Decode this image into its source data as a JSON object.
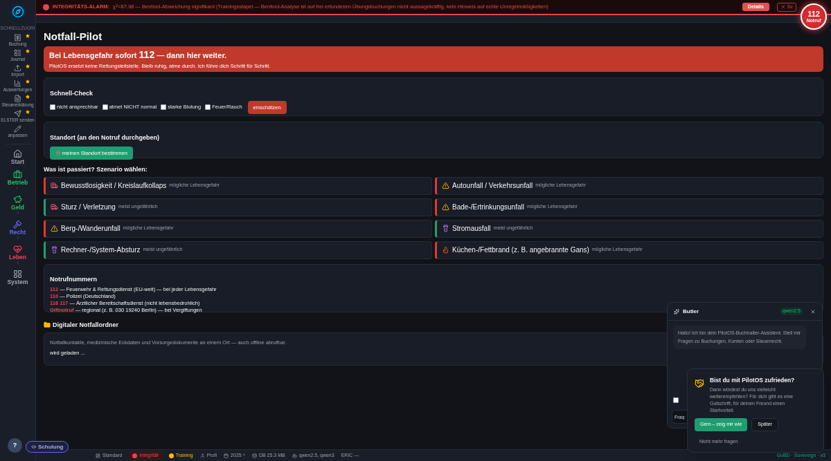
{
  "alarm": {
    "label": "INTEGRITÄTS-ALARM:",
    "message": "χ$^{2}$=87.98 — Benford-Abweichung signifikant (Trainingsstapel — Benford-Analyse ist auf frei erfundenen Übungsbuchungen nicht aussagekräftig, kein Hinweis auf echte Unregelmäßigkeiten)",
    "details": "Details",
    "close": "Sc"
  },
  "emergency_button": {
    "number": "112",
    "label": "Notruf"
  },
  "sidebar": {
    "section_label": "SCHNELLZUGRI",
    "quick_items": [
      {
        "label": "Buchung",
        "starred": true
      },
      {
        "label": "Journal",
        "starred": true
      },
      {
        "label": "Import",
        "starred": true
      },
      {
        "label": "Auswertungen",
        "starred": true
      },
      {
        "label": "Steuererklärung",
        "starred": true
      },
      {
        "label": "ELSTER senden",
        "starred": true
      },
      {
        "label": "anpassen",
        "starred": false
      }
    ],
    "sections": [
      {
        "label": "Start",
        "color": "#9ca3af",
        "expandable": false
      },
      {
        "label": "Betrieb",
        "color": "#22c55e",
        "expandable": true
      },
      {
        "label": "Geld",
        "color": "#22c55e",
        "expandable": true
      },
      {
        "label": "Recht",
        "color": "#6366f1",
        "expandable": true
      },
      {
        "label": "Leben",
        "color": "#f43f5e",
        "expandable": true
      },
      {
        "label": "System",
        "color": "#9ca3af",
        "expandable": true
      }
    ]
  },
  "title": "Notfall-Pilot",
  "banner": {
    "headline": "Bei Lebensgefahr sofort",
    "number": "112",
    "headline_rest": "— dann hier weiter.",
    "text": "PilotOS ersetzt keine Rettungsleitstelle. Bleib ruhig, atme durch. Ich führe dich Schritt für Schritt."
  },
  "quick_check": {
    "title": "Schnell-Check",
    "options": [
      {
        "label": "nicht ansprechbar",
        "checked": false
      },
      {
        "label": "atmet NICHT normal",
        "checked": false
      },
      {
        "label": "starke Blutung",
        "checked": false
      },
      {
        "label": "Feuer/Rauch",
        "checked": false
      }
    ],
    "button": "einschätzen"
  },
  "location": {
    "title": "Standort (an den Notruf durchgeben)",
    "button": "meinen Standort bestimmen"
  },
  "scenarios_label": "Was ist passiert? Szenario wählen:",
  "scenarios": [
    {
      "title": "Bewusstlosigkeit / Kreislaufkollaps",
      "tag": "mögliche Lebensgefahr",
      "kind": "danger"
    },
    {
      "title": "Autounfall / Verkehrsunfall",
      "tag": "mögliche Lebensgefahr",
      "kind": "danger"
    },
    {
      "title": "Sturz / Verletzung",
      "tag": "meist ungefährlich",
      "kind": "safe"
    },
    {
      "title": "Bade-/Ertrinkungsunfall",
      "tag": "mögliche Lebensgefahr",
      "kind": "danger"
    },
    {
      "title": "Berg-/Wanderunfall",
      "tag": "mögliche Lebensgefahr",
      "kind": "danger"
    },
    {
      "title": "Stromausfall",
      "tag": "meist ungefährlich",
      "kind": "safe"
    },
    {
      "title": "Rechner-/System-Absturz",
      "tag": "meist ungefährlich",
      "kind": "safe"
    },
    {
      "title": "Küchen-/Fettbrand (z. B. angebrannte Gans)",
      "tag": "mögliche Lebensgefahr",
      "kind": "danger"
    }
  ],
  "numbers": {
    "title": "Notrufnummern",
    "items": [
      {
        "number": "112",
        "text": "— Feuerwehr & Rettungsdienst (EU-weit) — bei jeder Lebensgefahr"
      },
      {
        "number": "110",
        "text": "— Polizei (Deutschland)"
      },
      {
        "number": "116 117",
        "text": "— Ärztlicher Bereitschaftsdienst (nicht lebensbedrohlich)"
      },
      {
        "number": "Giftnotruf",
        "text": "— regional (z. B. 030 19240 Berlin) — bei Vergiftungen"
      }
    ]
  },
  "folder": {
    "title": "Digitaler Notfallordner",
    "description": "Notfallkontakte, medizinische Eckdaten und Vorsorgedokumente an einem Ort — auch offline abrufbar.",
    "status": "wird geladen ..."
  },
  "butler": {
    "title": "Butler",
    "model": "qwen2.5",
    "message": "Hallo! Ich bin dein PilotOS-Buchhalter-Assistent. Stell mir Fragen zu Buchungen, Konten oder Steuerrecht.",
    "option_checked": false,
    "input_placeholder": "Frag"
  },
  "feedback": {
    "title": "Bist du mit PilotOS zufrieden?",
    "text": "Dann würdest du uns vielleicht weiterempfehlen? Für dich gibt es eine Gutschrift, für deinen Freund einen Startvorteil.",
    "primary": "Gern – zeig mir wie",
    "secondary": "Später",
    "dismiss": "Nicht mehr fragen"
  },
  "help": {
    "label": "?",
    "training": "Schulung"
  },
  "status_bar": {
    "items": [
      {
        "label": "Standard",
        "kind": "plain"
      },
      {
        "label": "Integrität",
        "kind": "alert"
      },
      {
        "label": "Training",
        "kind": "warn"
      },
      {
        "label": "Profi",
        "kind": "plain"
      },
      {
        "label": "2025 ^",
        "kind": "plain"
      },
      {
        "label": "DB 25.3 MB",
        "kind": "plain"
      },
      {
        "label": "qwen2.5, qwen3",
        "kind": "plain"
      },
      {
        "label": "ERIC —",
        "kind": "plain"
      }
    ],
    "version": "GoBD · Sovereign · v3"
  }
}
